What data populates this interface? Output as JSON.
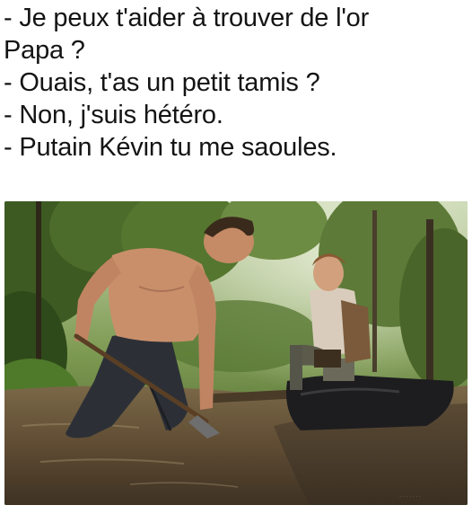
{
  "meme": {
    "lines": [
      "- Je peux t'aider à trouver de l'or",
      "Papa ?",
      "- Ouais, t'as un petit tamis ?",
      "- Non, j'suis hétéro.",
      "- Putain Kévin tu me saoules."
    ]
  },
  "photo": {
    "description_colors": {
      "foliage": "#4f6b2c",
      "water": "#6f5a3c",
      "skin": "#c98f6b",
      "shirt": "#d8cbbd"
    }
  }
}
